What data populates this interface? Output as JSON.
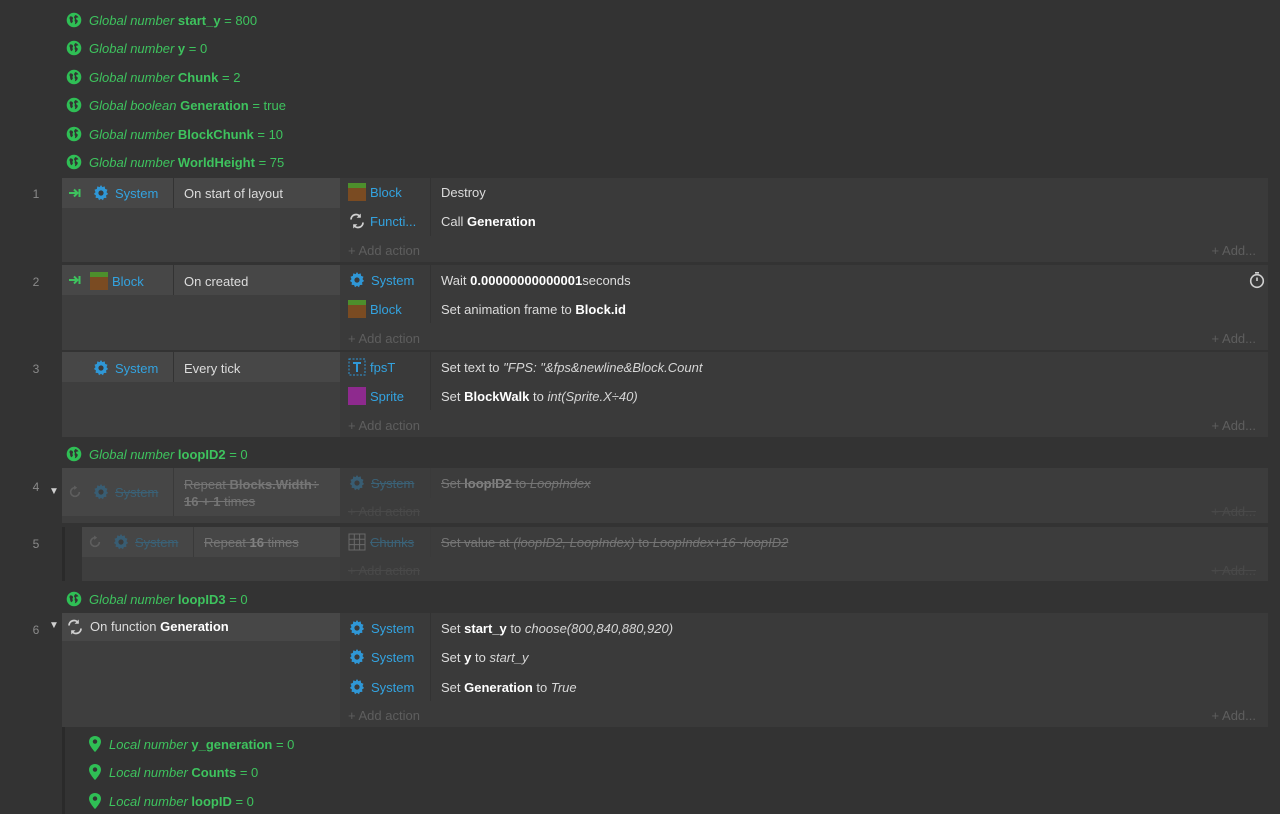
{
  "globals": [
    {
      "prefix": "Global number",
      "name": "start_y",
      "value": "= 800"
    },
    {
      "prefix": "Global number",
      "name": "y",
      "value": "= 0"
    },
    {
      "prefix": "Global number",
      "name": "Chunk",
      "value": "= 2"
    },
    {
      "prefix": "Global boolean",
      "name": "Generation",
      "value": "= true"
    },
    {
      "prefix": "Global number",
      "name": "BlockChunk",
      "value": "= 10"
    },
    {
      "prefix": "Global number",
      "name": "WorldHeight",
      "value": "= 75"
    }
  ],
  "add_action": "+ Add action",
  "add_more": "+ Add...",
  "events": [
    {
      "num": "1",
      "cond": {
        "obj": "System",
        "text": "On start of layout"
      },
      "actions": [
        {
          "obj": "Block",
          "pre": "Destroy",
          "bold": "",
          "post": ""
        },
        {
          "obj": "Functi...",
          "pre": "Call ",
          "bold": "Generation",
          "post": ""
        }
      ]
    },
    {
      "num": "2",
      "cond": {
        "obj": "Block",
        "text": "On created"
      },
      "actions": [
        {
          "obj": "System",
          "pre": "Wait ",
          "bold": "0.00000000000001",
          "post": " seconds"
        },
        {
          "obj": "Block",
          "pre": "Set animation frame to ",
          "bold": "Block.id",
          "post": ""
        }
      ]
    },
    {
      "num": "3",
      "cond": {
        "obj": "System",
        "text": "Every tick"
      },
      "actions": [
        {
          "obj": "fpsT",
          "pre": "Set text to ",
          "italic": "\"FPS: \"&fps&newline&Block.Count"
        },
        {
          "obj": "Sprite",
          "pre": "Set ",
          "bold": "BlockWalk",
          "mid": " to ",
          "italic": "int(Sprite.X÷40)"
        }
      ]
    },
    {
      "num": "4",
      "cond": {
        "obj": "System",
        "text1": "Repeat ",
        "bold": "Blocks.Width÷",
        "text2": "16 + 1",
        "text3": " times"
      },
      "actions": [
        {
          "obj": "System",
          "pre": "Set ",
          "bold": "loopID2",
          "mid": " to ",
          "italic": "LoopIndex"
        }
      ]
    },
    {
      "num": "5",
      "cond": {
        "obj": "System",
        "text": "Repeat ",
        "bold": "16",
        "post": " times"
      },
      "actions": [
        {
          "obj": "Chunks",
          "pre": "Set value at ",
          "italic": "(loopID2, LoopIndex)",
          "mid": " to ",
          "italic2": "LoopIndex+16 ·loopID2"
        }
      ]
    },
    {
      "num": "6",
      "cond": {
        "pre": "On function ",
        "bold": "Generation"
      },
      "actions": [
        {
          "obj": "System",
          "pre": "Set ",
          "bold": "start_y",
          "mid": " to ",
          "italic": "choose(800,840,880,920)"
        },
        {
          "obj": "System",
          "pre": "Set ",
          "bold": "y",
          "mid": " to ",
          "italic": "start_y"
        },
        {
          "obj": "System",
          "pre": "Set ",
          "bold": "Generation",
          "mid": " to ",
          "italic": "True"
        }
      ]
    }
  ],
  "loop_globals": [
    {
      "prefix": "Global number",
      "name": "loopID2",
      "value": "= 0"
    },
    {
      "prefix": "Global number",
      "name": "loopID3",
      "value": "= 0"
    }
  ],
  "locals": [
    {
      "prefix": "Local number",
      "name": "y_generation",
      "value": "= 0"
    },
    {
      "prefix": "Local number",
      "name": "Counts",
      "value": "= 0"
    },
    {
      "prefix": "Local number",
      "name": "loopID",
      "value": "= 0"
    }
  ],
  "colors": {
    "background": "#333333",
    "var_green": "#3ec35e",
    "object_blue": "#33a3e0"
  }
}
